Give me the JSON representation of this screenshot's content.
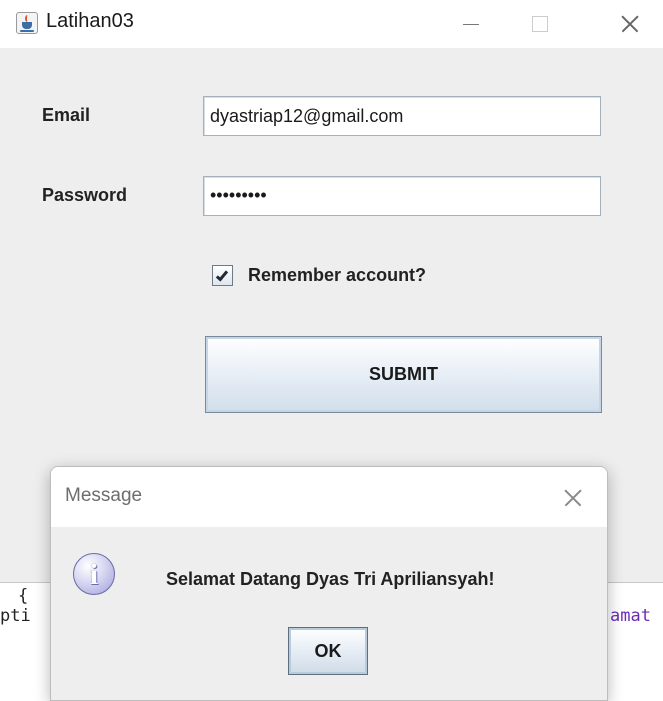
{
  "window": {
    "title": "Latihan03",
    "icon": "java-cup-icon"
  },
  "form": {
    "email_label": "Email",
    "email_value": "dyastriap12@gmail.com",
    "password_label": "Password",
    "password_mask": "•••••••••",
    "remember_checked": true,
    "remember_label": "Remember account?",
    "submit_label": "SUBMIT"
  },
  "background_code": {
    "line1": "{",
    "line2_left": "pti",
    "line2_right": "amat"
  },
  "dialog": {
    "title": "Message",
    "icon": "info-icon",
    "icon_glyph": "i",
    "message": "Selamat Datang Dyas Tri Apriliansyah!",
    "ok_label": "OK"
  }
}
